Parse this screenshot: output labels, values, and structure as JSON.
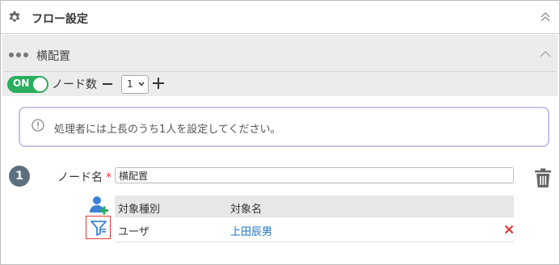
{
  "header": {
    "title": "フロー設定"
  },
  "section": {
    "title": "横配置"
  },
  "toolbar": {
    "toggle_label": "ON",
    "node_count_label": "ノード数",
    "node_count_value": "1"
  },
  "info": {
    "message": "処理者には上長のうち1人を設定してください。"
  },
  "node": {
    "number": "1",
    "name_label": "ノード名",
    "required_mark": "*",
    "name_value": "横配置",
    "table": {
      "headers": [
        "対象種別",
        "対象名"
      ],
      "rows": [
        {
          "type": "ユーザ",
          "name": "上田辰男"
        }
      ]
    }
  },
  "colors": {
    "toggle_on": "#2aad5d",
    "link": "#1a73c8",
    "delete": "#e53935",
    "info_border": "#c9c3e6",
    "add_user": "#3b82d6"
  },
  "icons": [
    "gear-icon",
    "double-chevron-up-icon",
    "dots-icon",
    "chevron-up-icon",
    "minus-icon",
    "plus-icon",
    "info-icon",
    "trash-icon",
    "add-user-icon",
    "filter-icon",
    "close-icon"
  ]
}
